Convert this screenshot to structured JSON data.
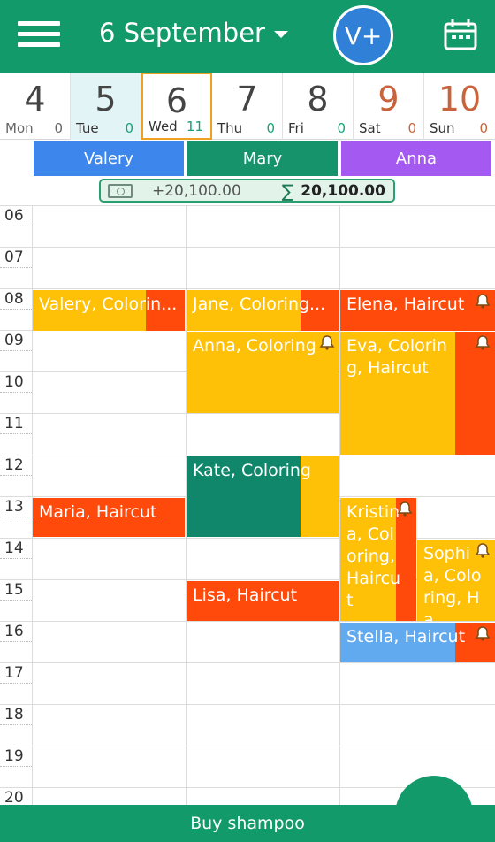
{
  "header": {
    "title": "6 September",
    "add_staff_label": "V+",
    "colors": {
      "bar": "#129a6b",
      "accent": "#2f80d6"
    }
  },
  "days": [
    {
      "num": "4",
      "weekday": "Mon",
      "count": "0"
    },
    {
      "num": "5",
      "weekday": "Tue",
      "count": "0"
    },
    {
      "num": "6",
      "weekday": "Wed",
      "count": "11"
    },
    {
      "num": "7",
      "weekday": "Thu",
      "count": "0"
    },
    {
      "num": "8",
      "weekday": "Fri",
      "count": "0"
    },
    {
      "num": "9",
      "weekday": "Sat",
      "count": "0"
    },
    {
      "num": "10",
      "weekday": "Sun",
      "count": "0"
    }
  ],
  "staff": [
    {
      "name": "Valery",
      "color": "#3d87ec"
    },
    {
      "name": "Mary",
      "color": "#16936b"
    },
    {
      "name": "Anna",
      "color": "#a45af0"
    }
  ],
  "summary": {
    "income": "+20,100.00",
    "total": "20,100.00"
  },
  "hours": [
    "06",
    "07",
    "08",
    "09",
    "10",
    "11",
    "12",
    "13",
    "14",
    "15",
    "16",
    "17",
    "18",
    "19",
    "20"
  ],
  "appointments": {
    "valery_coloring": "Valery, Colorin...",
    "jane": "Jane, Coloring...",
    "elena": "Elena, Haircut",
    "anna": "Anna, Coloring",
    "eva": "Eva, Coloring, Haircut",
    "kate": "Kate, Coloring",
    "maria": "Maria, Haircut",
    "kristina": "Kristina, Coloring, Haircut",
    "sophia": "Sophia, Coloring, Ha...",
    "lisa": "Lisa, Haircut",
    "stella": "Stella, Haircut"
  },
  "colors": {
    "yellow": "#ffc107",
    "orange": "#ff4a0c",
    "green": "#10876a",
    "blue": "#62aaf0"
  },
  "bottom": {
    "label": "Buy shampoo"
  }
}
